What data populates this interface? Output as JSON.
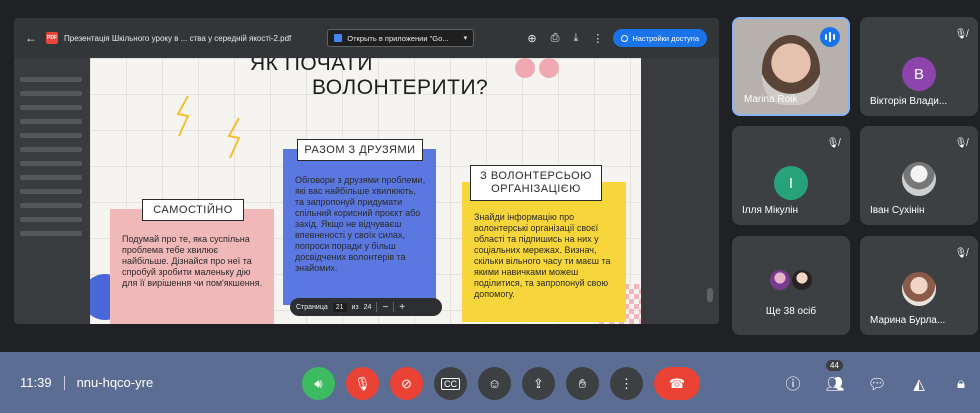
{
  "pdf_viewer": {
    "badge": "PDF",
    "title": "Презентація Шкільного уроку в ... ства у середній якості-2.pdf",
    "open_in": "Открыть в приложении \"Go...",
    "access_button": "Настройки доступа"
  },
  "slide": {
    "title_line1": "ЯК ПОЧАТИ",
    "title_line2": "ВОЛОНТЕРИТИ?",
    "cards": [
      {
        "heading": "САМОСТІЙНО",
        "body": "Подумай про те, яка суспільна проблема тебе хвилює найбільше. Дізнайся про неї та спробуй зробити маленьку дію для її вирішення чи пом'якшення."
      },
      {
        "heading": "РАЗОМ З ДРУЗЯМИ",
        "body": "Обговори з друзями проблеми, які вас найбільше хвилюють, та запропонуй придумати спільний корисний проєкт або захід. Якщо не відчуваєш впевненості у своїх силах, попроси поради у більш досвідчених волонтерів та знайомих."
      },
      {
        "heading": "З ВОЛОНТЕРСЬОЮ ОРГАНІЗАЦІЄЮ",
        "body": "Знайди інформацію про волонтерські організації своєї області та підпишись на них у соціальних мережах. Визнач, скільки вільного часу ти маєш та якими навичками можеш поділитися, та запропонуй свою допомогу."
      }
    ],
    "pagination": {
      "label": "Страница",
      "current": "21",
      "of": "из",
      "total": "24",
      "zoom_out": "−",
      "zoom_in": "+"
    }
  },
  "participants": [
    {
      "name": "Marina Roik",
      "speaking": true
    },
    {
      "name": "Вікторія Влади...",
      "initial": "В",
      "color": "#8e44ad"
    },
    {
      "name": "Ілля Мікулін",
      "initial": "І",
      "color": "#27a37a"
    },
    {
      "name": "Іван Сухінін"
    },
    {
      "name": "Ще 38 осіб"
    },
    {
      "name": "Марина Бурла..."
    }
  ],
  "bottom_bar": {
    "time": "11:39",
    "meeting_code": "nnu-hqco-yre",
    "participants_count": "44",
    "end_call_icon": "phone-hangup-icon"
  }
}
